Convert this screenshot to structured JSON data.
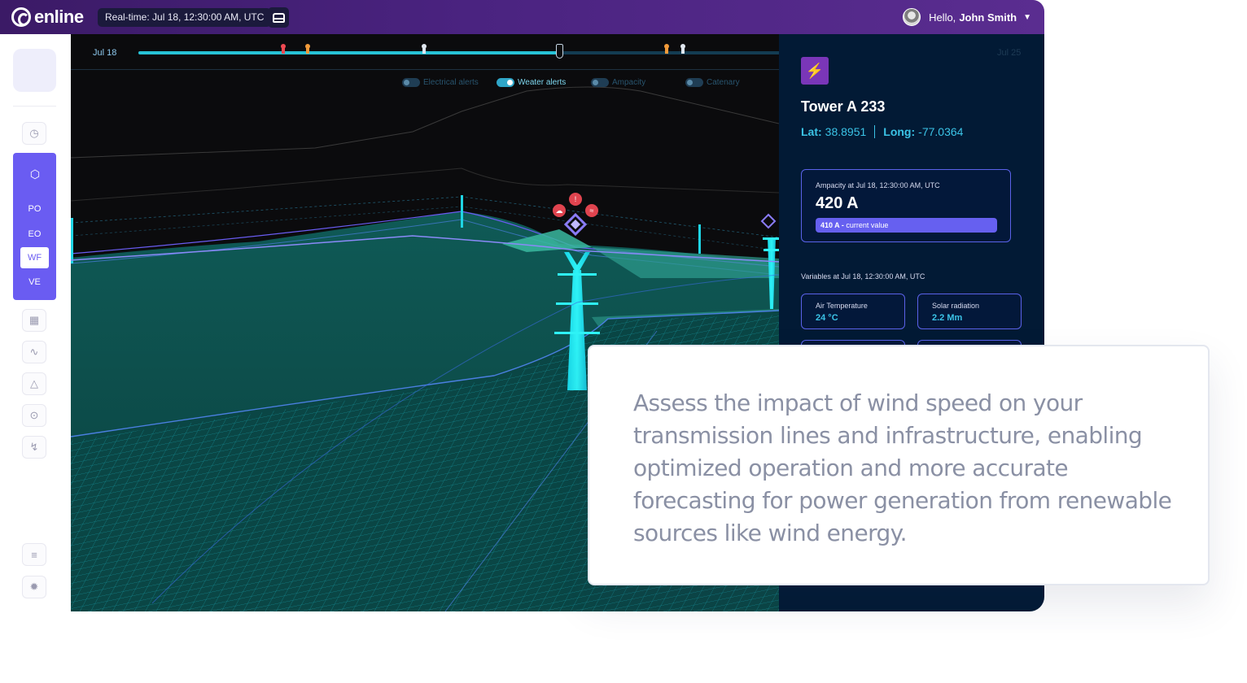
{
  "header": {
    "logo_text": "enline",
    "realtime_label": "Real-time: Jul 18, 12:30:00 AM, UTC",
    "greeting": "Hello,",
    "user_name": "John Smith"
  },
  "sidebar": {
    "submenu": [
      "PO",
      "EO",
      "WF",
      "VE"
    ],
    "selected_submenu": "WF",
    "icons": [
      "dashboard-icon",
      "cube-icon",
      "map-icon",
      "activity-icon",
      "alert-triangle-icon",
      "broadcast-icon",
      "route-icon",
      "sliders-icon",
      "settings-icon"
    ]
  },
  "timeline": {
    "start_label": "Jul 18",
    "end_label": "Jul 25"
  },
  "toggles": [
    {
      "label": "Electrical alerts",
      "on": false
    },
    {
      "label": "Weater alerts",
      "on": true
    },
    {
      "label": "Ampacity",
      "on": false
    },
    {
      "label": "Catenary",
      "on": false
    }
  ],
  "panel": {
    "tower_name": "Tower A 233",
    "lat_label": "Lat:",
    "lat_value": "38.8951",
    "long_label": "Long:",
    "long_value": "-77.0364",
    "ampacity_caption": "Ampacity at Jul 18, 12:30:00 AM, UTC",
    "ampacity_value": "420 A",
    "current_value_strong": "410 A -",
    "current_value_text": "current value",
    "variables_caption": "Variables at Jul 18, 12:30:00 AM, UTC",
    "variables": [
      {
        "label": "Air Temperature",
        "value": "24 °C"
      },
      {
        "label": "Solar radiation",
        "value": "2.2 Mm"
      }
    ]
  },
  "caption": {
    "text": "Assess the impact of wind speed on your transmission lines and infrastructure, enabling optimized operation and more accurate forecasting for power generation from renewable sources like wind energy."
  },
  "colors": {
    "header_gradient_start": "#3b1a66",
    "header_gradient_end": "#5a2d90",
    "accent_purple": "#6a5cf2",
    "terrain_teal": "#0e5350",
    "tower_cyan": "#22e6f0",
    "panel_bg": "#021a35",
    "alert_red": "#e0444f"
  }
}
